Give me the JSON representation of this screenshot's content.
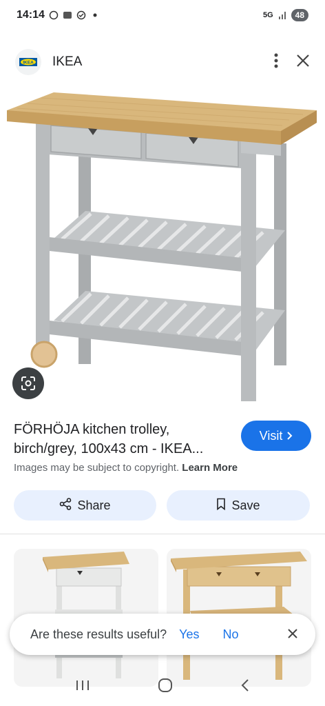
{
  "status_bar": {
    "time": "14:14",
    "network": "5G",
    "battery": "48"
  },
  "header": {
    "site_name": "IKEA",
    "logo_text": "IKEA"
  },
  "result": {
    "title": "FÖRHÖJA kitchen trolley, birch/grey, 100x43 cm - IKEA...",
    "visit_label": "Visit",
    "copyright_text": "Images may be subject to copyright.",
    "learn_more": "Learn More"
  },
  "actions": {
    "share_label": "Share",
    "save_label": "Save"
  },
  "feedback": {
    "question": "Are these results useful?",
    "yes_label": "Yes",
    "no_label": "No"
  },
  "colors": {
    "accent": "#1a73e8",
    "button_bg": "#e8f0fe",
    "birch": "#d9b77c",
    "grey_frame": "#b9bcbe"
  }
}
